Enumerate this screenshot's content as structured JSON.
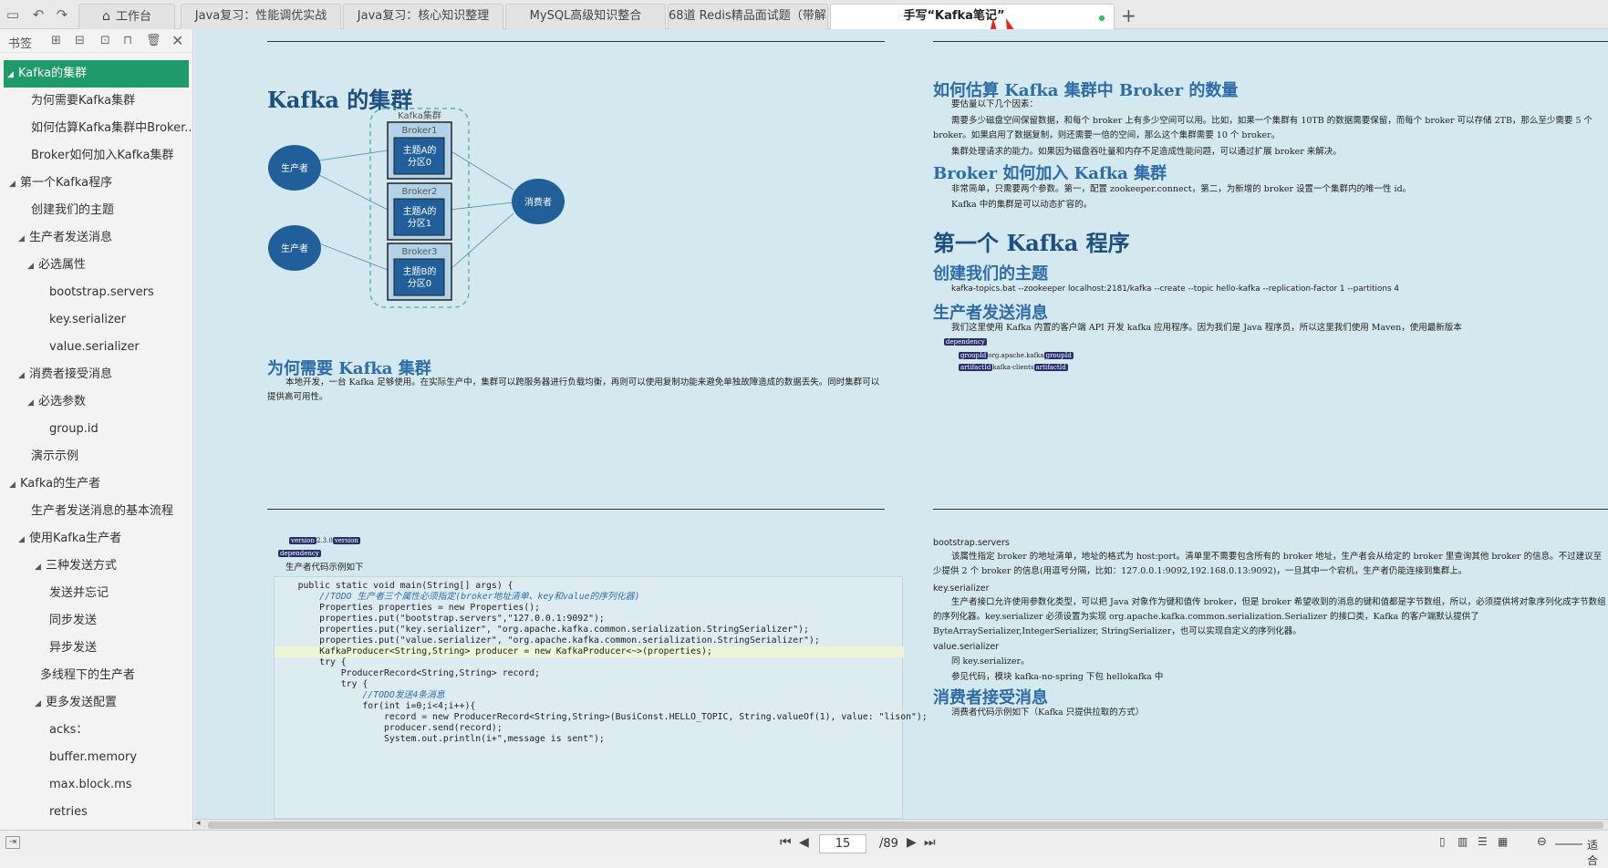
{
  "tabs": [
    {
      "label": "工作台"
    },
    {
      "label": "Java复习：性能调优实战"
    },
    {
      "label": "Java复习：核心知识整理"
    },
    {
      "label": "MySQL高级知识整合"
    },
    {
      "label": "68道 Redis精品面试题（带解..."
    },
    {
      "label": "手写“Kafka笔记”"
    }
  ],
  "sidebar": {
    "title": "书签",
    "items": [
      {
        "label": "Kafka的集群"
      },
      {
        "label": "为何需要Kafka集群"
      },
      {
        "label": "如何估算Kafka集群中Broker..."
      },
      {
        "label": "Broker如何加入Kafka集群"
      },
      {
        "label": "第一个Kafka程序"
      },
      {
        "label": "创建我们的主题"
      },
      {
        "label": "生产者发送消息"
      },
      {
        "label": "必选属性"
      },
      {
        "label": "bootstrap.servers"
      },
      {
        "label": "key.serializer"
      },
      {
        "label": "value.serializer"
      },
      {
        "label": "消费者接受消息"
      },
      {
        "label": "必选参数"
      },
      {
        "label": "group.id"
      },
      {
        "label": "演示示例"
      },
      {
        "label": "Kafka的生产者"
      },
      {
        "label": "生产者发送消息的基本流程"
      },
      {
        "label": "使用Kafka生产者"
      },
      {
        "label": "三种发送方式"
      },
      {
        "label": "发送并忘记"
      },
      {
        "label": "同步发送"
      },
      {
        "label": "异步发送"
      },
      {
        "label": "多线程下的生产者"
      },
      {
        "label": "更多发送配置"
      },
      {
        "label": "acks："
      },
      {
        "label": "buffer.memory"
      },
      {
        "label": "max.block.ms"
      },
      {
        "label": "retries"
      }
    ]
  },
  "page1": {
    "title": "Kafka 的集群",
    "diagram": {
      "cluster_label": "Kafka集群",
      "producer1": "生产者",
      "producer2": "生产者",
      "consumer": "消费者",
      "b1": "Broker1",
      "p1a": "主题A的",
      "p1b": "分区0",
      "b2": "Broker2",
      "p2a": "主题A的",
      "p2b": "分区1",
      "b3": "Broker3",
      "p3a": "主题B的",
      "p3b": "分区0"
    },
    "h_why": "为何需要 Kafka 集群",
    "why_text": "本地开发，一台 Kafka 足够使用。在实际生产中，集群可以跨服务器进行负载均衡，再则可以使用复制功能来避免单独故障造成的数据丢失。同时集群可以提供高可用性。"
  },
  "page2": {
    "h_estimate": "如何估算 Kafka 集群中 Broker 的数量",
    "p1": "要估量以下几个因素：",
    "p2": "需要多少磁盘空间保留数据，和每个 broker 上有多少空间可以用。比如，如果一个集群有 10TB 的数据需要保留，而每个 broker 可以存储 2TB，那么至少需要 5 个 broker。如果启用了数据复制，则还需要一倍的空间，那么这个集群需要 10 个 broker。",
    "p3": "集群处理请求的能力。如果因为磁盘吞吐量和内存不足造成性能问题，可以通过扩展 broker 来解决。",
    "h_join": "Broker 如何加入 Kafka 集群",
    "p4": "非常简单，只需要两个参数。第一，配置 zookeeper.connect，第二，为新增的 broker 设置一个集群内的唯一性 id。",
    "p5": "Kafka 中的集群是可以动态扩容的。",
    "h_first": "第一个 Kafka 程序",
    "h_topic": "创建我们的主题",
    "p6": "kafka-topics.bat --zookeeper localhost:2181/kafka --create --topic hello-kafka --replication-factor 1 --partitions 4",
    "h_send": "生产者发送消息",
    "p7": "我们这里使用 Kafka 内置的客户端 API 开发 kafka 应用程序。因为我们是 Java 程序员，所以这里我们使用 Maven，使用最新版本",
    "x1": "dependency",
    "x2": "groupId",
    "x2v": "org.apache.kafka",
    "x3": "artifactId",
    "x3v": "kafka-clients"
  },
  "page3": {
    "x_version": "version",
    "x_version_v": "2.3.0",
    "x_dep": "dependency",
    "caption": "生产者代码示例如下",
    "code": [
      "    public static void main(String[] args) {",
      "        //TODO 生产者三个属性必须指定(broker地址清单、key和value的序列化器)",
      "        Properties properties = new Properties();",
      "        properties.put(\"bootstrap.servers\",\"127.0.0.1:9092\");",
      "        properties.put(\"key.serializer\", \"org.apache.kafka.common.serialization.StringSerializer\");",
      "        properties.put(\"value.serializer\", \"org.apache.kafka.common.serialization.StringSerializer\");",
      "        KafkaProducer<String,String> producer = new KafkaProducer<~>(properties);",
      "        try {",
      "            ProducerRecord<String,String> record;",
      "            try {",
      "                //TODO发送4条消息",
      "                for(int i=0;i<4;i++){",
      "                    record = new ProducerRecord<String,String>(BusiConst.HELLO_TOPIC, String.valueOf(1), value: \"lison\");",
      "                    producer.send(record);",
      "                    System.out.println(i+\",message is sent\");"
    ]
  },
  "page4": {
    "t_boot": "bootstrap.servers",
    "p_boot": "该属性指定 broker 的地址清单，地址的格式为 host:port。清单里不需要包含所有的 broker 地址，生产者会从给定的 broker 里查询其他 broker 的信息。不过建议至少提供 2 个 broker 的信息(用逗号分隔，比如：127.0.0.1:9092,192.168.0.13:9092)，一旦其中一个宕机，生产者仍能连接到集群上。",
    "t_key": "key.serializer",
    "p_key": "生产者接口允许使用参数化类型，可以把 Java 对象作为键和值传 broker，但是 broker 希望收到的消息的键和值都是字节数组，所以，必须提供将对象序列化成字节数组的序列化器。key.serializer 必须设置为实现 org.apache.kafka.common.serialization.Serializer 的接口类，Kafka 的客户端默认提供了 ByteArraySerializer,IntegerSerializer, StringSerializer，也可以实现自定义的序列化器。",
    "t_val": "value.serializer",
    "p_val1": "同 key.serializer。",
    "p_val2": "参见代码，模块 kafka-no-spring 下包 hellokafka 中",
    "h_consumer": "消费者接受消息",
    "p_consumer": "消费者代码示例如下（Kafka 只提供拉取的方式）"
  },
  "status": {
    "page": "15",
    "total": "/89",
    "fit": "适合"
  }
}
